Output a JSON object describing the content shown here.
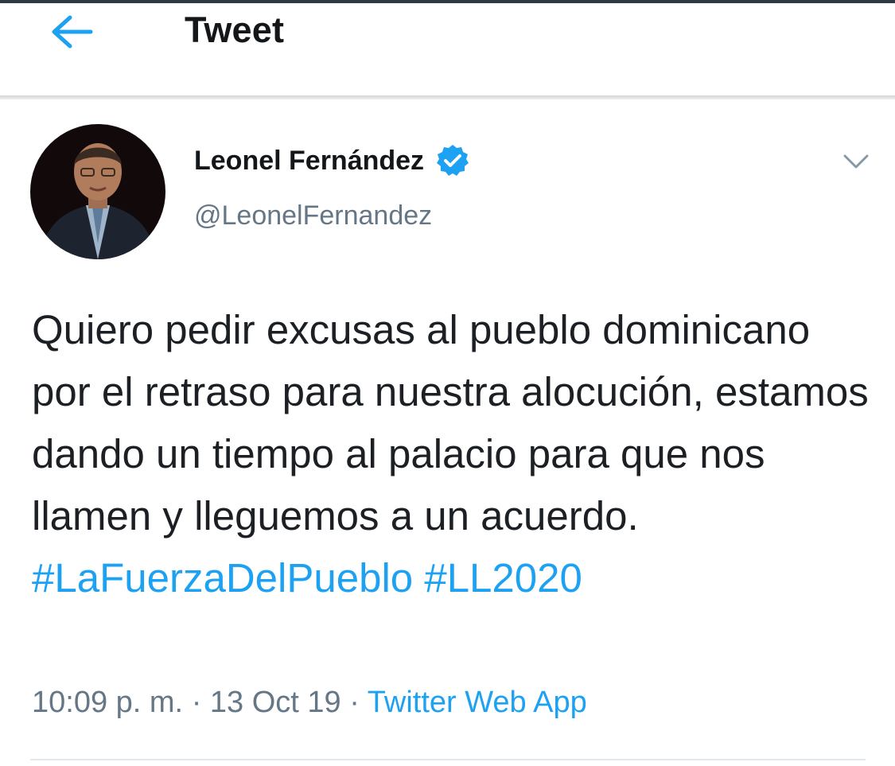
{
  "header": {
    "title": "Tweet",
    "back_icon": "arrow-left-icon"
  },
  "author": {
    "display_name": "Fernández",
    "display_name_full": "Leonel Fernández",
    "handle": "@LeonelFernandez",
    "verified_icon": "verified-badge-icon",
    "avatar_icon": "avatar"
  },
  "tweet": {
    "text": "Quiero pedir excusas al pueblo dominicano por el retraso para nuestra alocución, estamos dando un tiempo al palacio para que nos llamen y lleguemos a un acuerdo.",
    "hashtags": [
      "#LaFuerzaDelPueblo",
      "#LL2020"
    ],
    "time": "10:09 p. m.",
    "separator": "·",
    "date": "13 Oct 19",
    "source": "Twitter Web App"
  },
  "menu": {
    "caret_icon": "chevron-down-icon"
  },
  "colors": {
    "accent": "#1da1f2",
    "secondary_text": "#657786",
    "primary_text": "#14171a"
  }
}
